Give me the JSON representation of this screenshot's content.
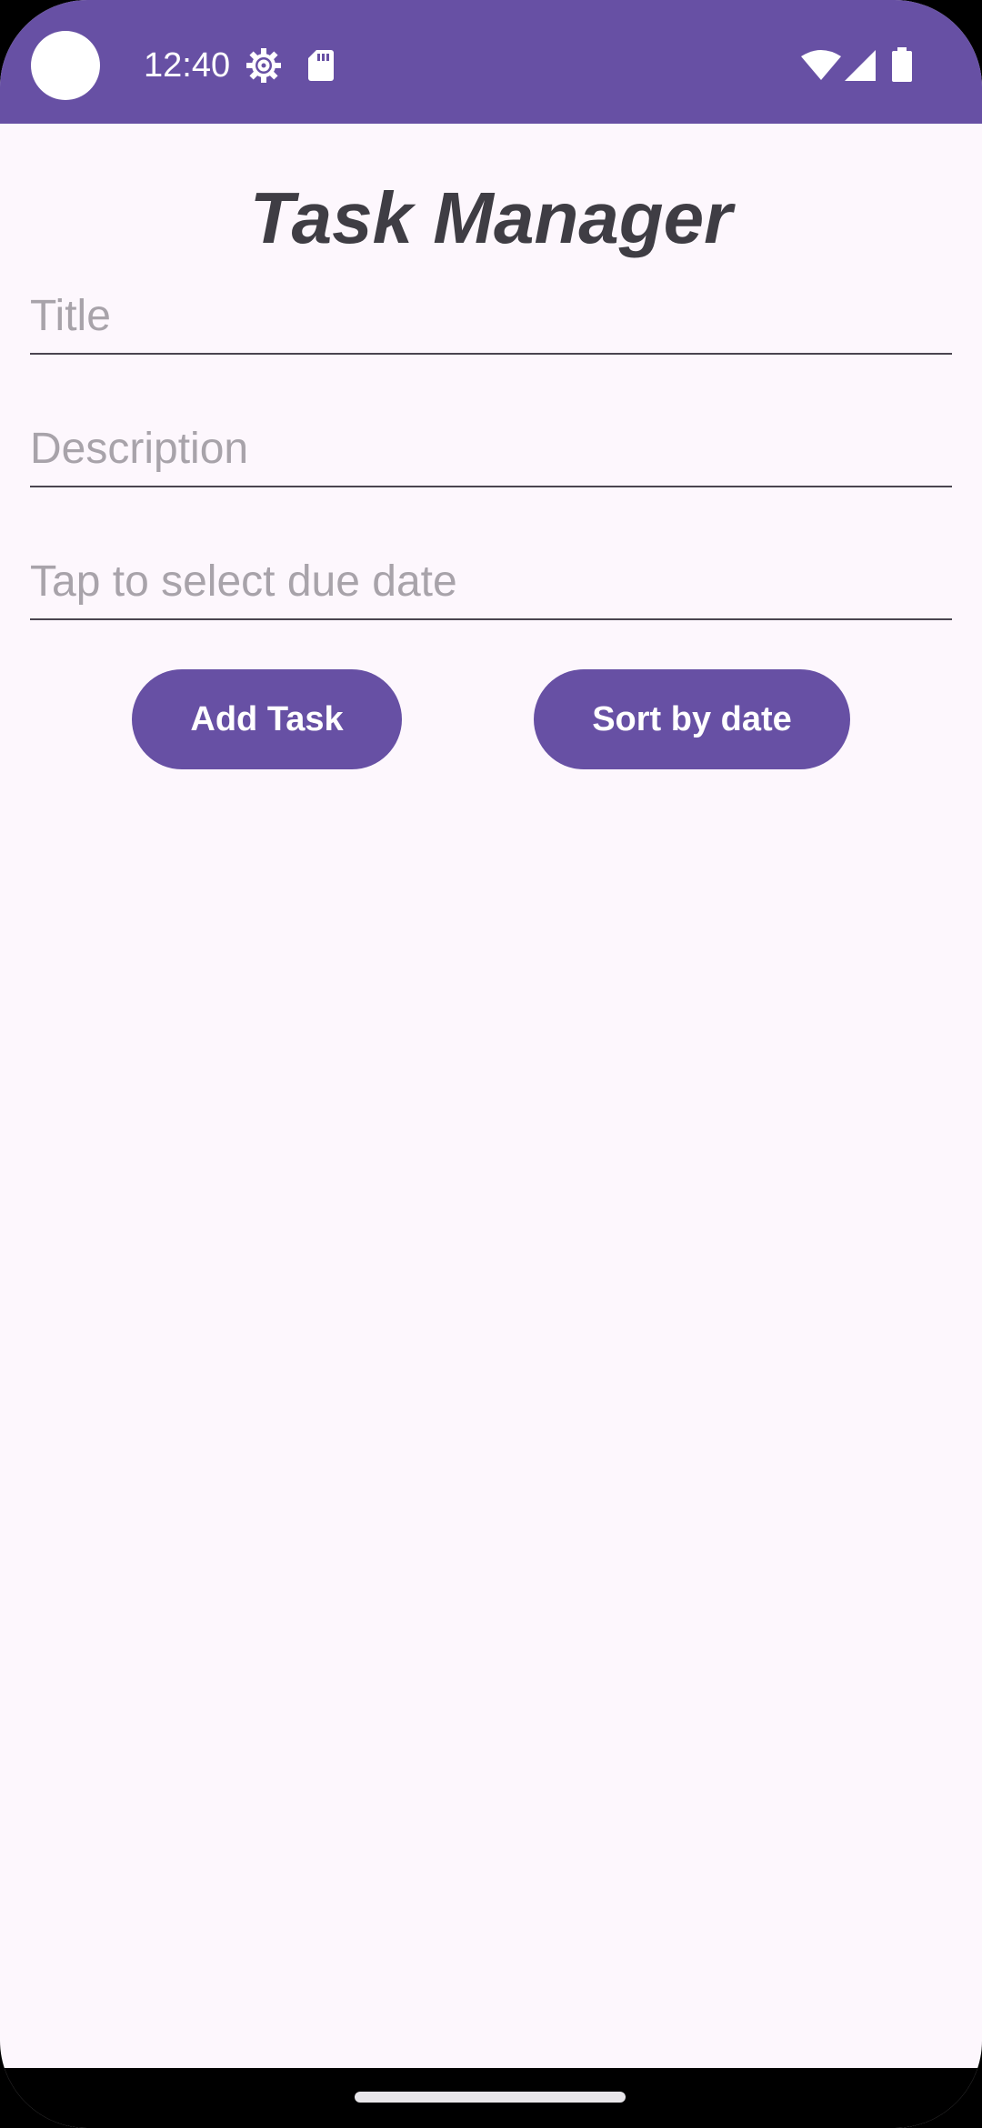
{
  "status_bar": {
    "time": "12:40",
    "icons": [
      "gear-icon",
      "sd-card-icon",
      "wifi-icon",
      "cell-signal-icon",
      "battery-icon"
    ],
    "color": "#6750A4"
  },
  "main": {
    "title": "Task Manager",
    "fields": {
      "title": {
        "value": "",
        "placeholder": "Title"
      },
      "description": {
        "value": "",
        "placeholder": "Description"
      },
      "due_date": {
        "value": "",
        "placeholder": "Tap to select due date"
      }
    },
    "buttons": {
      "add_task": "Add Task",
      "sort_by_date": "Sort by date"
    }
  },
  "colors": {
    "accent": "#6750A4",
    "background": "#FDF7FD",
    "title_text": "#3F3D44",
    "placeholder_text": "#A8A3AA"
  }
}
